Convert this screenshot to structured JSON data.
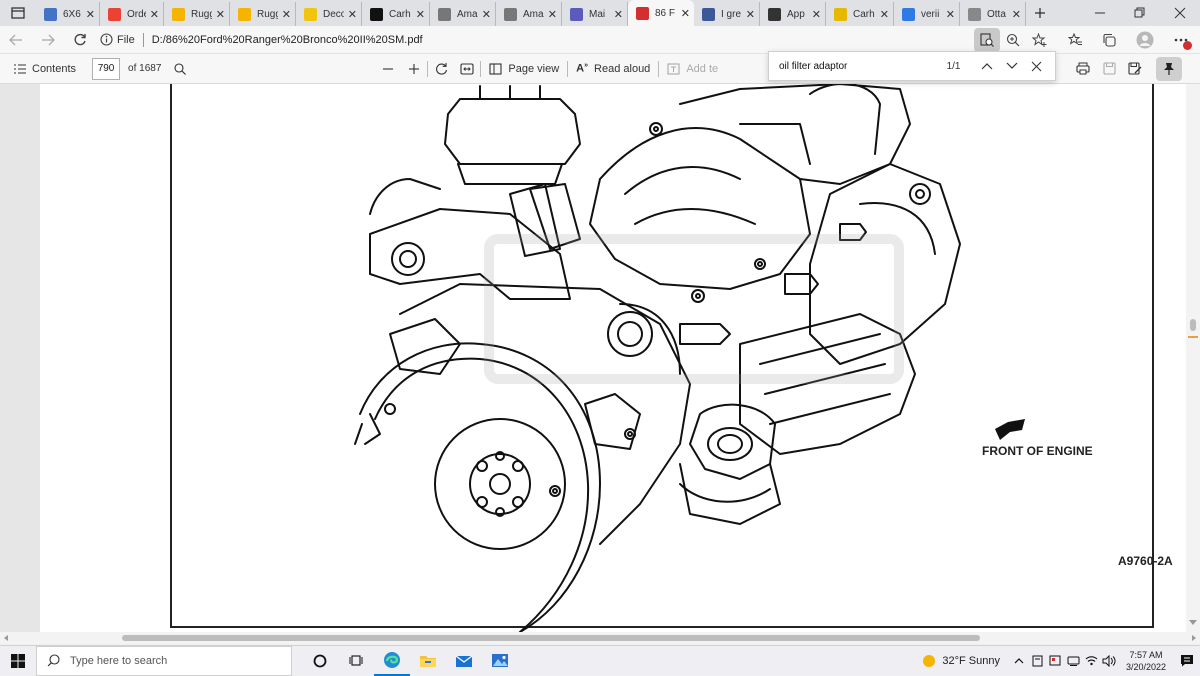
{
  "tabs": [
    {
      "label": "6X6",
      "fav_color": "#4472c4",
      "active": false
    },
    {
      "label": "Orde",
      "fav_color": "#ea4335",
      "active": false
    },
    {
      "label": "Rugg",
      "fav_color": "#f4b400",
      "active": false
    },
    {
      "label": "Rugg",
      "fav_color": "#f4b400",
      "active": false
    },
    {
      "label": "Deco",
      "fav_color": "#f1c40f",
      "active": false
    },
    {
      "label": "Carh",
      "fav_color": "#111111",
      "active": false
    },
    {
      "label": "Ama",
      "fav_color": "#777777",
      "active": false
    },
    {
      "label": "Ama",
      "fav_color": "#777777",
      "active": false
    },
    {
      "label": "Mai",
      "fav_color": "#5b5bbd",
      "active": false
    },
    {
      "label": "86 F",
      "fav_color": "#d32f2f",
      "active": true
    },
    {
      "label": "I gre",
      "fav_color": "#3b5998",
      "active": false
    },
    {
      "label": "App",
      "fav_color": "#333333",
      "active": false
    },
    {
      "label": "Carh",
      "fav_color": "#e6b800",
      "active": false
    },
    {
      "label": "verii",
      "fav_color": "#2f7ae5",
      "active": false
    },
    {
      "label": "Otta",
      "fav_color": "#888888",
      "active": false
    }
  ],
  "address": {
    "file_label": "File",
    "url": "D:/86%20Ford%20Ranger%20Bronco%20II%20SM.pdf"
  },
  "pdf_toolbar": {
    "contents_label": "Contents",
    "page_number": "790",
    "page_total": "of 1687",
    "page_view_label": "Page view",
    "read_aloud_label": "Read aloud",
    "add_text_label": "Add te"
  },
  "find": {
    "query": "oil filter adaptor",
    "count": "1/1"
  },
  "document": {
    "front_label": "FRONT OF ENGINE",
    "figure_id": "A9760-2A"
  },
  "taskbar": {
    "search_placeholder": "Type here to search",
    "weather": "32°F  Sunny",
    "time": "7:57 AM",
    "date": "3/20/2022"
  },
  "colors": {
    "accent": "#0078d4",
    "pdf_red": "#d32f2f"
  }
}
